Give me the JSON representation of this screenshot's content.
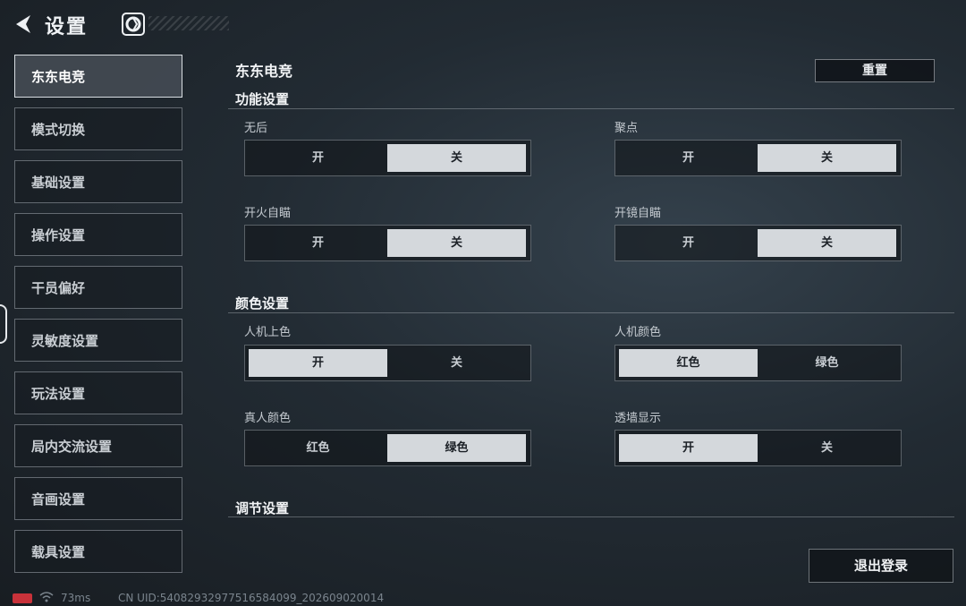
{
  "header": {
    "title": "设置"
  },
  "sidebar": {
    "items": [
      {
        "label": "东东电竞",
        "active": true
      },
      {
        "label": "模式切换"
      },
      {
        "label": "基础设置"
      },
      {
        "label": "操作设置"
      },
      {
        "label": "干员偏好"
      },
      {
        "label": "灵敏度设置"
      },
      {
        "label": "玩法设置"
      },
      {
        "label": "局内交流设置"
      },
      {
        "label": "音画设置"
      },
      {
        "label": "载具设置"
      }
    ]
  },
  "main": {
    "page_title": "东东电竞",
    "reset_label": "重置",
    "sections": {
      "function": {
        "title": "功能设置",
        "options": [
          {
            "label": "无后",
            "left": "开",
            "right": "关",
            "selected": "right"
          },
          {
            "label": "聚点",
            "left": "开",
            "right": "关",
            "selected": "right"
          },
          {
            "label": "开火自瞄",
            "left": "开",
            "right": "关",
            "selected": "right"
          },
          {
            "label": "开镜自瞄",
            "left": "开",
            "right": "关",
            "selected": "right"
          }
        ]
      },
      "color": {
        "title": "颜色设置",
        "options": [
          {
            "label": "人机上色",
            "left": "开",
            "right": "关",
            "selected": "left"
          },
          {
            "label": "人机颜色",
            "left": "红色",
            "right": "绿色",
            "selected": "left"
          },
          {
            "label": "真人颜色",
            "left": "红色",
            "right": "绿色",
            "selected": "right"
          },
          {
            "label": "透墙显示",
            "left": "开",
            "right": "关",
            "selected": "left"
          }
        ]
      },
      "adjust": {
        "title": "调节设置"
      }
    },
    "logout_label": "退出登录"
  },
  "status": {
    "ping": "73ms",
    "uid": "CN UID:54082932977516584099_202609020014"
  },
  "colors": {
    "battery": "#c8323a",
    "selected_segment": "#d4d8dc"
  }
}
